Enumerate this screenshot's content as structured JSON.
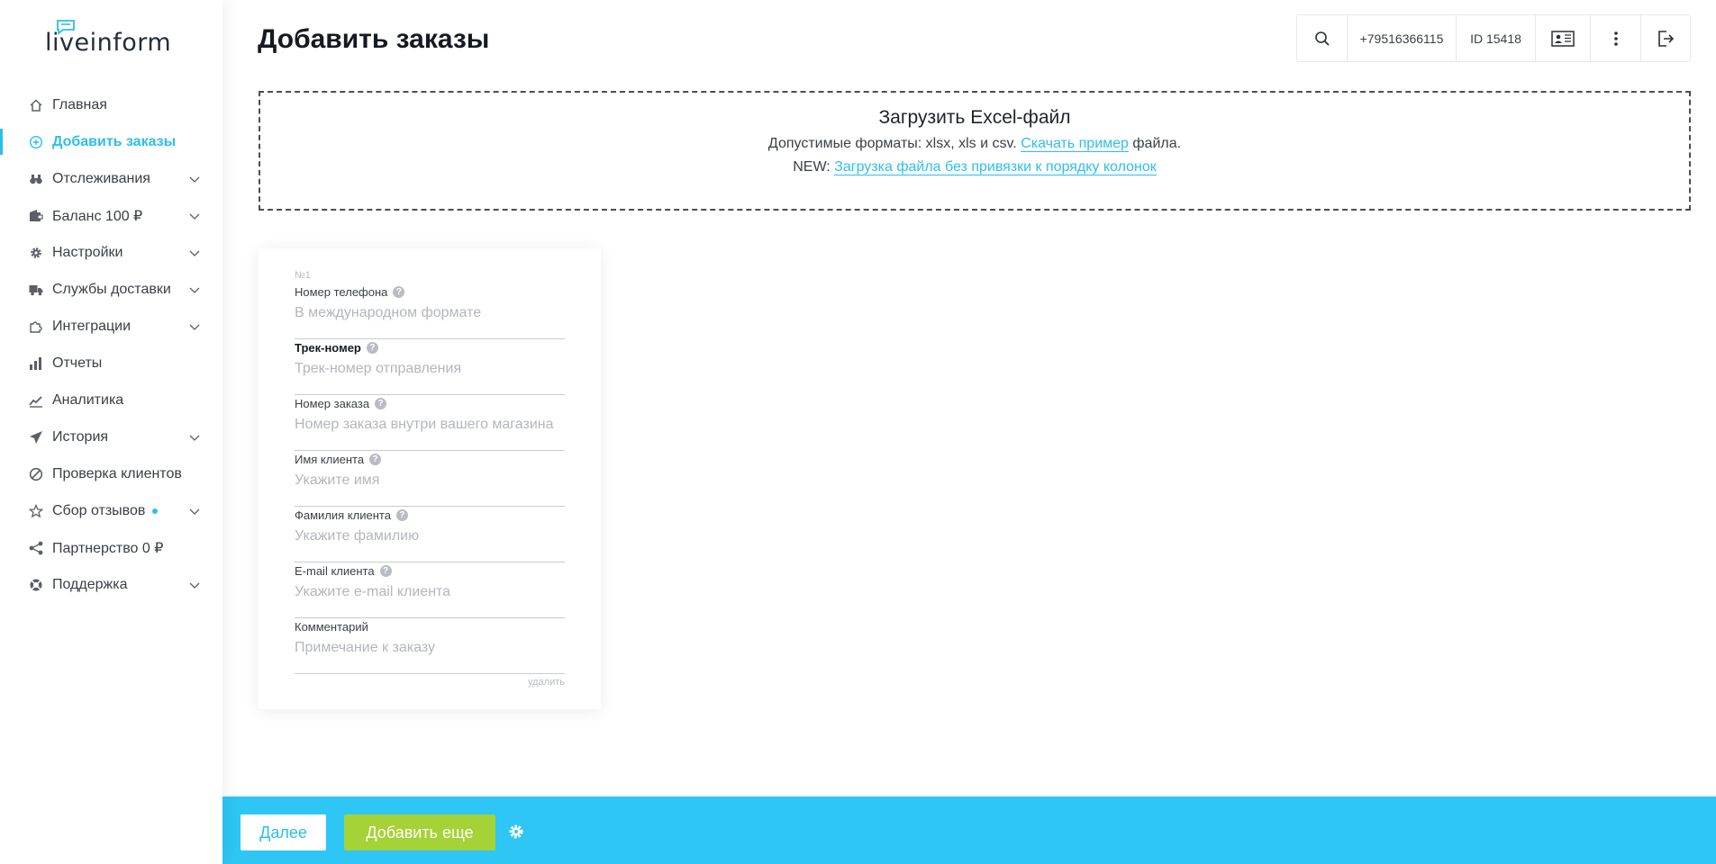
{
  "brand": {
    "logo_text": "liveinform",
    "accent_color": "#2cbfeb",
    "bottom_bar_color": "#2dc6f5",
    "add_button_color": "#a5d236"
  },
  "sidebar": {
    "items": [
      {
        "label": "Главная",
        "icon": "home-icon",
        "has_submenu": false
      },
      {
        "label": "Добавить заказы",
        "icon": "plus-circle-icon",
        "has_submenu": false,
        "active": true
      },
      {
        "label": "Отслеживания",
        "icon": "binoculars-icon",
        "has_submenu": true
      },
      {
        "label": "Баланс 100 ₽",
        "icon": "wallet-icon",
        "has_submenu": true
      },
      {
        "label": "Настройки",
        "icon": "gear-icon",
        "has_submenu": true
      },
      {
        "label": "Службы доставки",
        "icon": "truck-icon",
        "has_submenu": true
      },
      {
        "label": "Интеграции",
        "icon": "puzzle-icon",
        "has_submenu": true
      },
      {
        "label": "Отчеты",
        "icon": "bar-chart-icon",
        "has_submenu": false
      },
      {
        "label": "Аналитика",
        "icon": "line-chart-icon",
        "has_submenu": false
      },
      {
        "label": "История",
        "icon": "paper-plane-icon",
        "has_submenu": true
      },
      {
        "label": "Проверка клиентов",
        "icon": "ban-icon",
        "has_submenu": false
      },
      {
        "label": "Сбор отзывов",
        "icon": "star-icon",
        "has_submenu": true,
        "badge_dot": true
      },
      {
        "label": "Партнерство 0 ₽",
        "icon": "share-icon",
        "has_submenu": false
      },
      {
        "label": "Поддержка",
        "icon": "lifebuoy-icon",
        "has_submenu": true
      }
    ]
  },
  "header": {
    "title": "Добавить заказы",
    "phone": "+79516366115",
    "account_id": "ID 15418",
    "icons": [
      "search-icon",
      "id-card-icon",
      "more-vertical-icon",
      "logout-icon"
    ]
  },
  "upload": {
    "title": "Загрузить Excel-файл",
    "formats_prefix": "Допустимые форматы: xlsx, xls и csv. ",
    "sample_link": "Скачать пример",
    "formats_suffix": " файла.",
    "new_prefix": "NEW: ",
    "new_link": "Загрузка файла без привязки к порядку колонок"
  },
  "order_form": {
    "number": "№1",
    "fields": [
      {
        "label": "Номер телефона",
        "placeholder": "В международном формате",
        "help": true,
        "bold": false
      },
      {
        "label": "Трек-номер",
        "placeholder": "Трек-номер отправления",
        "help": true,
        "bold": true
      },
      {
        "label": "Номер заказа",
        "placeholder": "Номер заказа внутри вашего магазина",
        "help": true,
        "bold": false
      },
      {
        "label": "Имя клиента",
        "placeholder": "Укажите имя",
        "help": true,
        "bold": false
      },
      {
        "label": "Фамилия клиента",
        "placeholder": "Укажите фамилию",
        "help": true,
        "bold": false
      },
      {
        "label": "E-mail клиента",
        "placeholder": "Укажите e-mail клиента",
        "help": true,
        "bold": false
      },
      {
        "label": "Комментарий",
        "placeholder": "Примечание к заказу",
        "help": false,
        "bold": false
      }
    ],
    "delete_label": "удалить"
  },
  "footer": {
    "next_label": "Далее",
    "add_more_label": "Добавить еще"
  }
}
